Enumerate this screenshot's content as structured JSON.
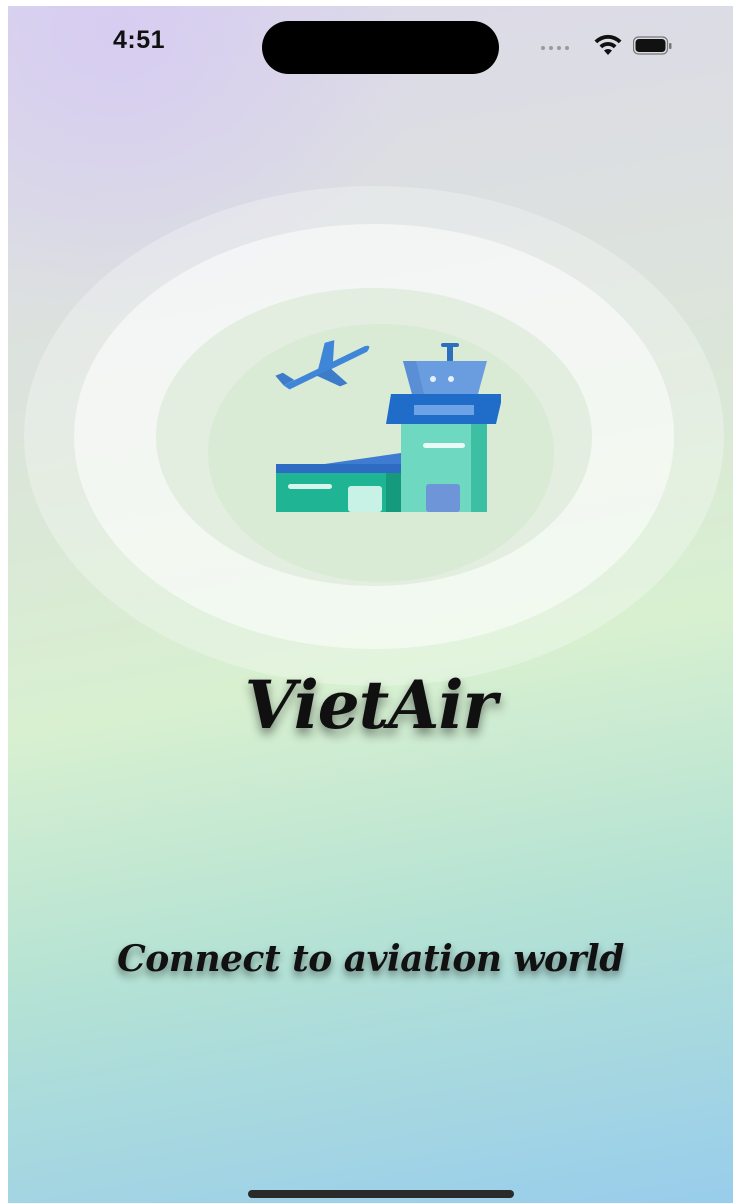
{
  "status_bar": {
    "time": "4:51",
    "icons": [
      "cellular-dots-icon",
      "wifi-icon",
      "battery-icon"
    ]
  },
  "splash": {
    "logo_icon": "airport-tower-plane-icon",
    "title": "VietAir",
    "tagline": "Connect to aviation world"
  },
  "colors": {
    "gradient_top": "#dcd8ea",
    "gradient_middle": "#d8f0d0",
    "gradient_bottom": "#98cdec",
    "text": "#101010",
    "logo_blue": "#2e7bd6",
    "logo_teal": "#1fb594"
  }
}
